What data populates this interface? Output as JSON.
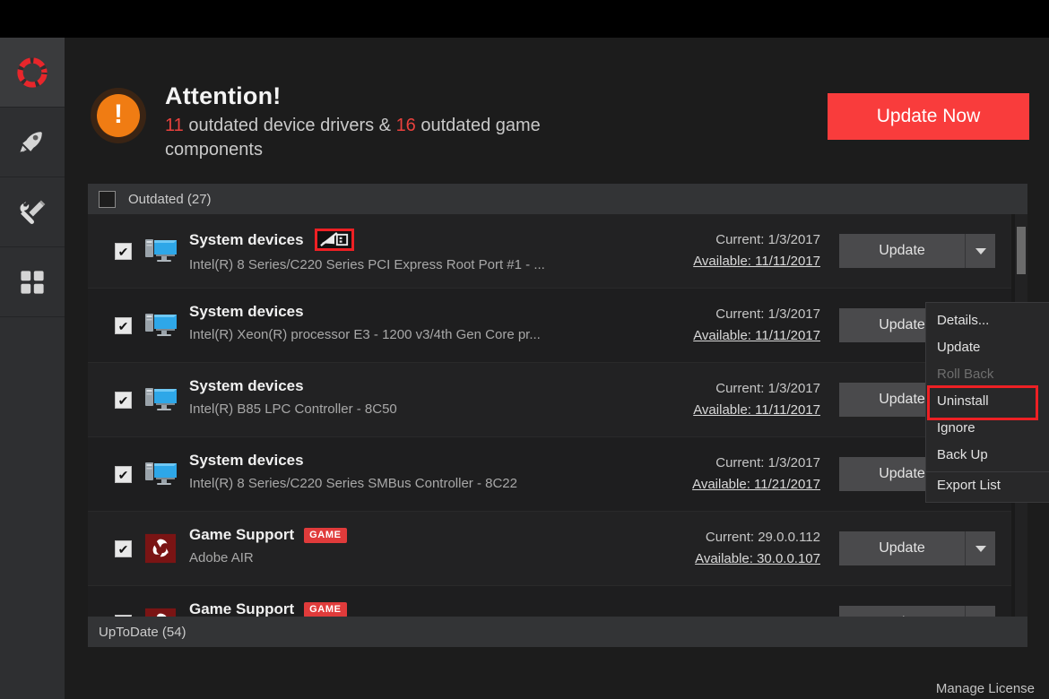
{
  "sidebar": {
    "items": [
      {
        "name": "support",
        "icon": "lifebuoy-icon",
        "active": true
      },
      {
        "name": "boost",
        "icon": "rocket-icon",
        "active": false
      },
      {
        "name": "tools",
        "icon": "wrench-screwdriver-icon",
        "active": false
      },
      {
        "name": "apps",
        "icon": "grid-apps-icon",
        "active": false
      }
    ]
  },
  "header": {
    "badge_glyph": "!",
    "title": "Attention!",
    "summary_count_drivers": "11",
    "summary_mid": " outdated device drivers & ",
    "summary_count_games": "16",
    "summary_tail": " outdated game components",
    "update_now_label": "Update Now",
    "accent_red": "#f93c3c",
    "badge_orange": "#f07c13"
  },
  "groups": {
    "outdated_label": "Outdated (27)",
    "uptodate_label": "UpToDate (54)"
  },
  "rows": [
    {
      "checked": true,
      "icon": "computer-device-icon",
      "title": "System devices",
      "has_highlight_icon": true,
      "highlight_icon_name": "disabled-device-icon",
      "subtitle": "Intel(R) 8 Series/C220 Series PCI Express Root Port #1 - ...",
      "current": "Current: 1/3/2017",
      "available": "Available: 11/11/2017",
      "button_label": "Update"
    },
    {
      "checked": true,
      "icon": "computer-device-icon",
      "title": "System devices",
      "has_highlight_icon": false,
      "subtitle": "Intel(R) Xeon(R) processor E3 - 1200 v3/4th Gen Core pr...",
      "current": "Current: 1/3/2017",
      "available": "Available: 11/11/2017",
      "button_label": "Update"
    },
    {
      "checked": true,
      "icon": "computer-device-icon",
      "title": "System devices",
      "has_highlight_icon": false,
      "subtitle": "Intel(R) B85 LPC Controller - 8C50",
      "current": "Current: 1/3/2017",
      "available": "Available: 11/11/2017",
      "button_label": "Update"
    },
    {
      "checked": true,
      "icon": "computer-device-icon",
      "title": "System devices",
      "has_highlight_icon": false,
      "subtitle": "Intel(R) 8 Series/C220 Series SMBus Controller - 8C22",
      "current": "Current: 1/3/2017",
      "available": "Available: 11/21/2017",
      "button_label": "Update"
    },
    {
      "checked": true,
      "icon": "adobe-air-icon",
      "title": "Game Support",
      "tag": "GAME",
      "has_highlight_icon": false,
      "subtitle": "Adobe AIR",
      "current": "Current: 29.0.0.112",
      "available": "Available: 30.0.0.107",
      "button_label": "Update"
    },
    {
      "checked": true,
      "icon": "adobe-air-icon",
      "title": "Game Support",
      "tag": "GAME",
      "has_highlight_icon": false,
      "subtitle": "",
      "current": "",
      "available": "",
      "button_label": "Update"
    }
  ],
  "context_menu": {
    "items": [
      {
        "label": "Details...",
        "disabled": false,
        "highlighted": false,
        "separator": false
      },
      {
        "label": "Update",
        "disabled": false,
        "highlighted": false,
        "separator": false
      },
      {
        "label": "Roll Back",
        "disabled": true,
        "highlighted": false,
        "separator": false
      },
      {
        "label": "Uninstall",
        "disabled": false,
        "highlighted": true,
        "separator": false
      },
      {
        "label": "Ignore",
        "disabled": false,
        "highlighted": false,
        "separator": false
      },
      {
        "label": "Back Up",
        "disabled": false,
        "highlighted": false,
        "separator": false
      },
      {
        "label": "Export List",
        "disabled": false,
        "highlighted": false,
        "separator": true
      }
    ],
    "highlight_color": "#ed2024"
  },
  "footer": {
    "manage_license_label": "Manage License"
  }
}
